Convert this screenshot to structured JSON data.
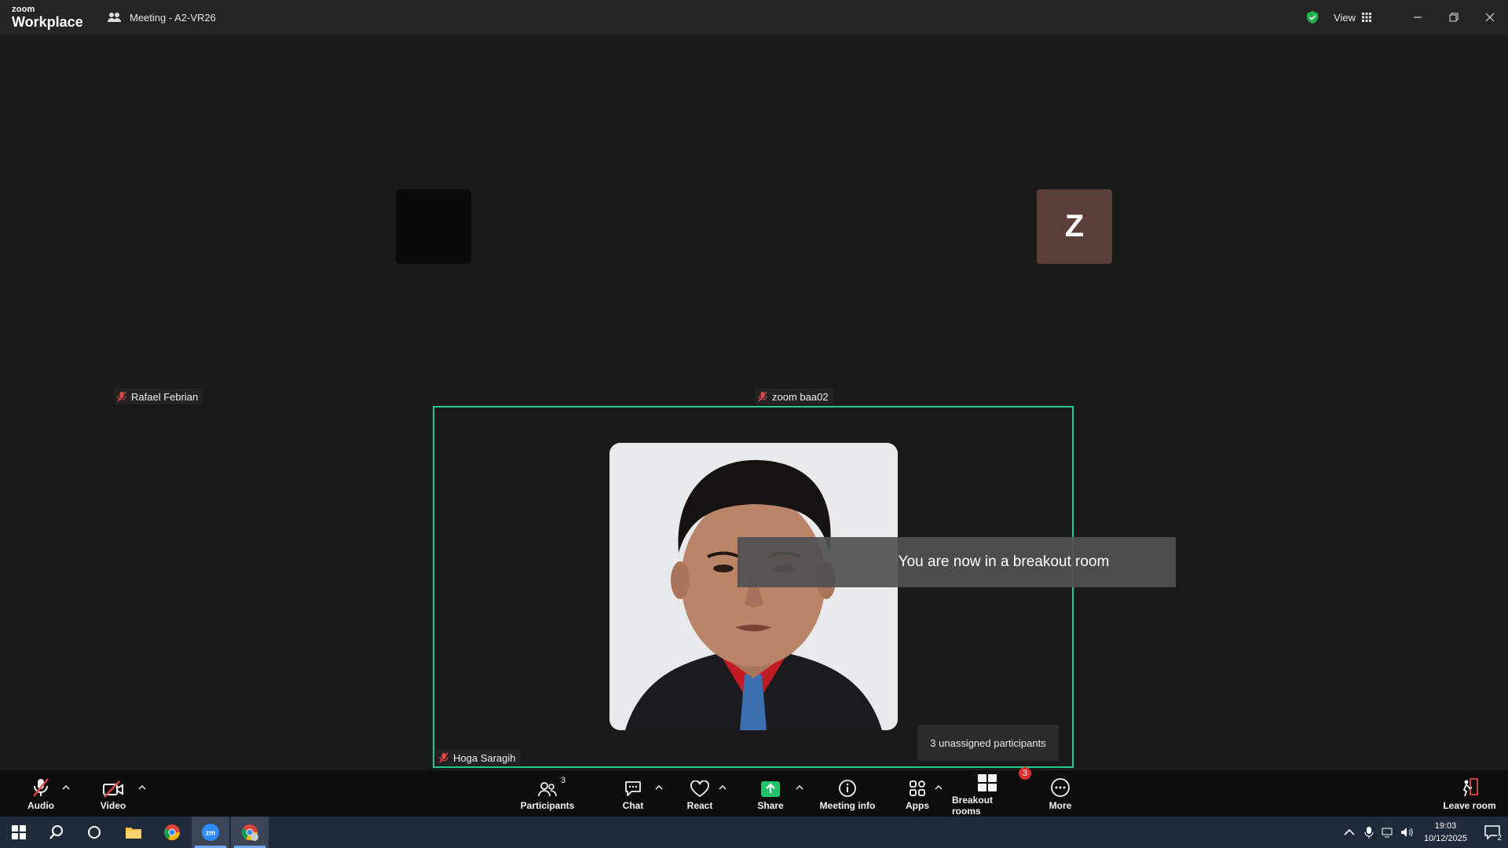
{
  "app": {
    "logo_line1": "zoom",
    "logo_line2": "Workplace",
    "meeting_title": "Meeting - A2-VR26",
    "view_label": "View"
  },
  "stage": {
    "tiles": [
      {
        "name": "Rafael Febrian",
        "muted": true
      },
      {
        "name": "zoom baa02",
        "avatar_letter": "Z",
        "muted": true
      }
    ],
    "active_speaker": {
      "name": "Hoga Saragih",
      "muted": true
    },
    "toast": "You are now in a breakout room",
    "unassigned_popup": "3 unassigned participants"
  },
  "toolbar": {
    "audio": "Audio",
    "video": "Video",
    "participants": "Participants",
    "participants_count": "3",
    "chat": "Chat",
    "react": "React",
    "share": "Share",
    "meeting_info": "Meeting info",
    "apps": "Apps",
    "breakout_rooms": "Breakout rooms",
    "breakout_badge": "3",
    "more": "More",
    "leave_room": "Leave room"
  },
  "taskbar": {
    "time": "19:03",
    "date": "10/12/2025",
    "notifications": "2",
    "apps": [
      "windows-start",
      "search",
      "task-view",
      "file-explorer",
      "chrome",
      "zoom",
      "chrome-profile"
    ]
  },
  "colors": {
    "active_border": "#22c98a",
    "share_green": "#23c26a",
    "avatar_bg": "#5a3f38",
    "badge_red": "#e02f2f",
    "muted_red": "#e04646"
  }
}
